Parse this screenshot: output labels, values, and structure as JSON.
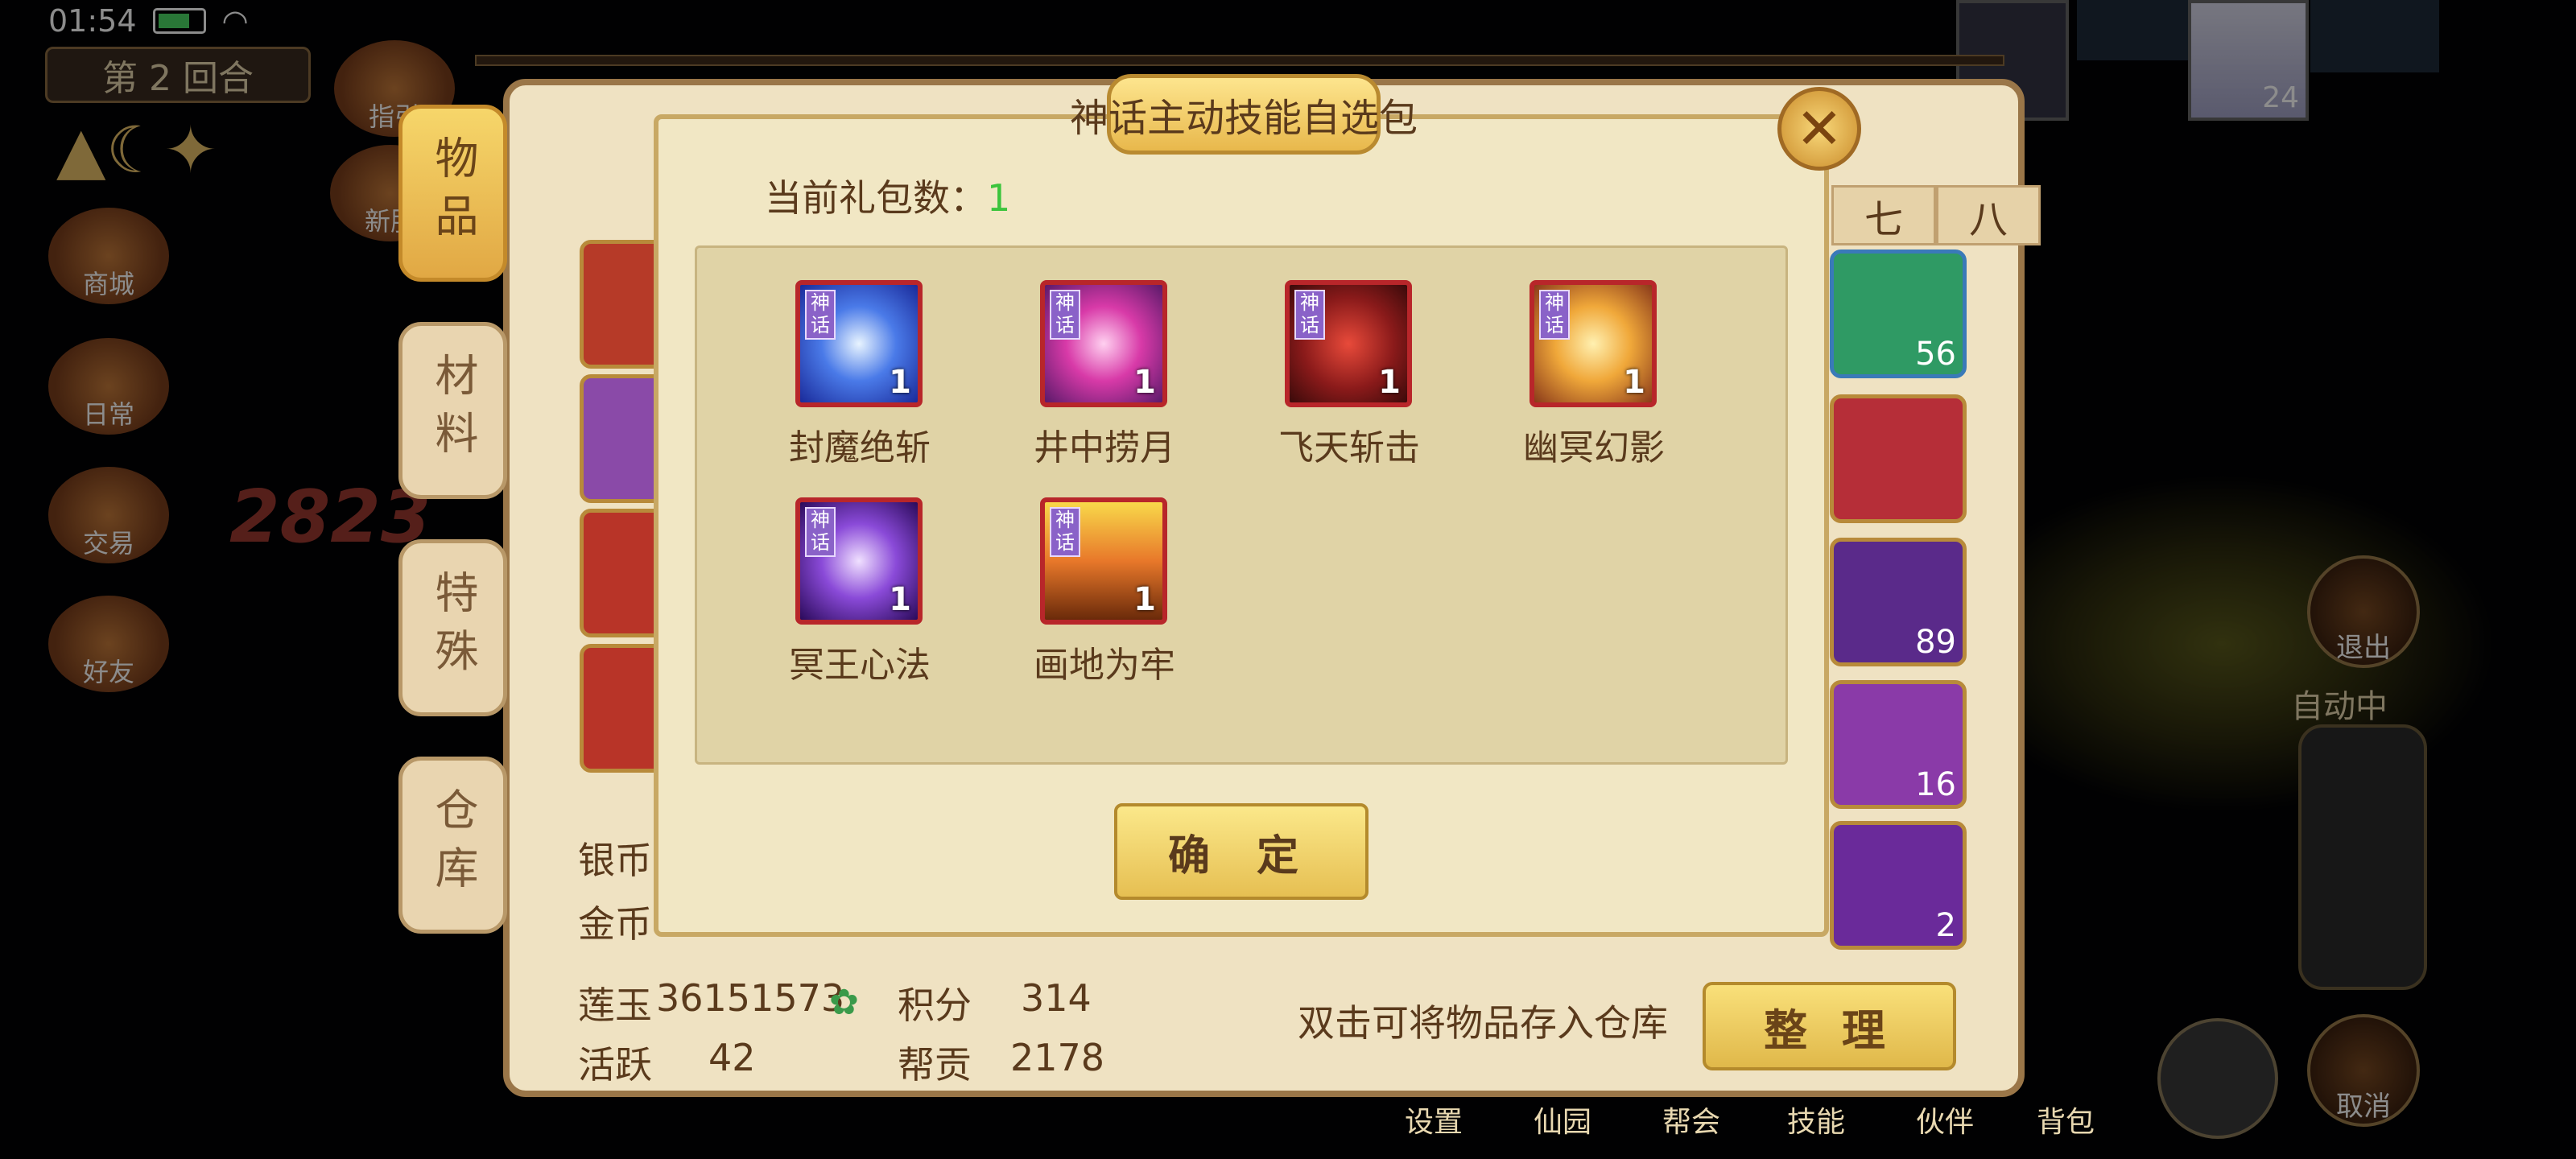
{
  "status_bar": {
    "time": "01:54"
  },
  "hud": {
    "round_label": "第 2 回合",
    "combat_number": "2823",
    "left_icons": [
      {
        "label": "指引"
      },
      {
        "label": "新服"
      },
      {
        "label": "商城"
      },
      {
        "label": "日常"
      },
      {
        "label": "交易"
      },
      {
        "label": "好友"
      }
    ],
    "player_level": "24",
    "right_buttons": [
      {
        "label": "退出"
      },
      {
        "label": "取消"
      }
    ],
    "auto_label": "自动中",
    "bottom_nav": [
      "设置",
      "仙园",
      "帮会",
      "技能",
      "伙伴",
      "背包"
    ]
  },
  "bag": {
    "side_tabs": [
      {
        "label": "物品",
        "active": true
      },
      {
        "label": "材料",
        "active": false
      },
      {
        "label": "特殊",
        "active": false
      },
      {
        "label": "仓库",
        "active": false
      }
    ],
    "page_tabs": [
      "七",
      "八"
    ],
    "right_items": [
      {
        "qty": "56",
        "color": "#2f9a64"
      },
      {
        "qty": "",
        "color": "#b62e38"
      },
      {
        "qty": "89",
        "color": "#5a2a8a"
      },
      {
        "qty": "16",
        "color": "#c8862a"
      },
      {
        "qty": "2",
        "color": "#6a2a9a"
      }
    ],
    "currency": {
      "silver_label": "银币",
      "gold_label": "金币",
      "lianyu_label": "莲玉",
      "lianyu_value": "36151573",
      "points_label": "积分",
      "points_value": "314",
      "active_label": "活跃",
      "active_value": "42",
      "contrib_label": "帮贡",
      "contrib_value": "2178"
    },
    "hint": "双击可将物品存入仓库",
    "sort_button": "整 理"
  },
  "dialog": {
    "title": "神话主动技能自选包",
    "pack_count_label": "当前礼包数：",
    "pack_count_value": "1",
    "skills": [
      {
        "name": "封魔绝斩",
        "qty": "1",
        "badge": "神话",
        "color": "#2a5ad8"
      },
      {
        "name": "井中捞月",
        "qty": "1",
        "badge": "神话",
        "color": "#c42aa8"
      },
      {
        "name": "飞天斩击",
        "qty": "1",
        "badge": "神话",
        "color": "#8a1a1a"
      },
      {
        "name": "幽冥幻影",
        "qty": "1",
        "badge": "神话",
        "color": "#d8742a"
      },
      {
        "name": "冥王心法",
        "qty": "1",
        "badge": "神话",
        "color": "#6a2ab8"
      },
      {
        "name": "画地为牢",
        "qty": "1",
        "badge": "神话",
        "color": "#d85a1a"
      }
    ],
    "confirm_button": "确 定"
  }
}
